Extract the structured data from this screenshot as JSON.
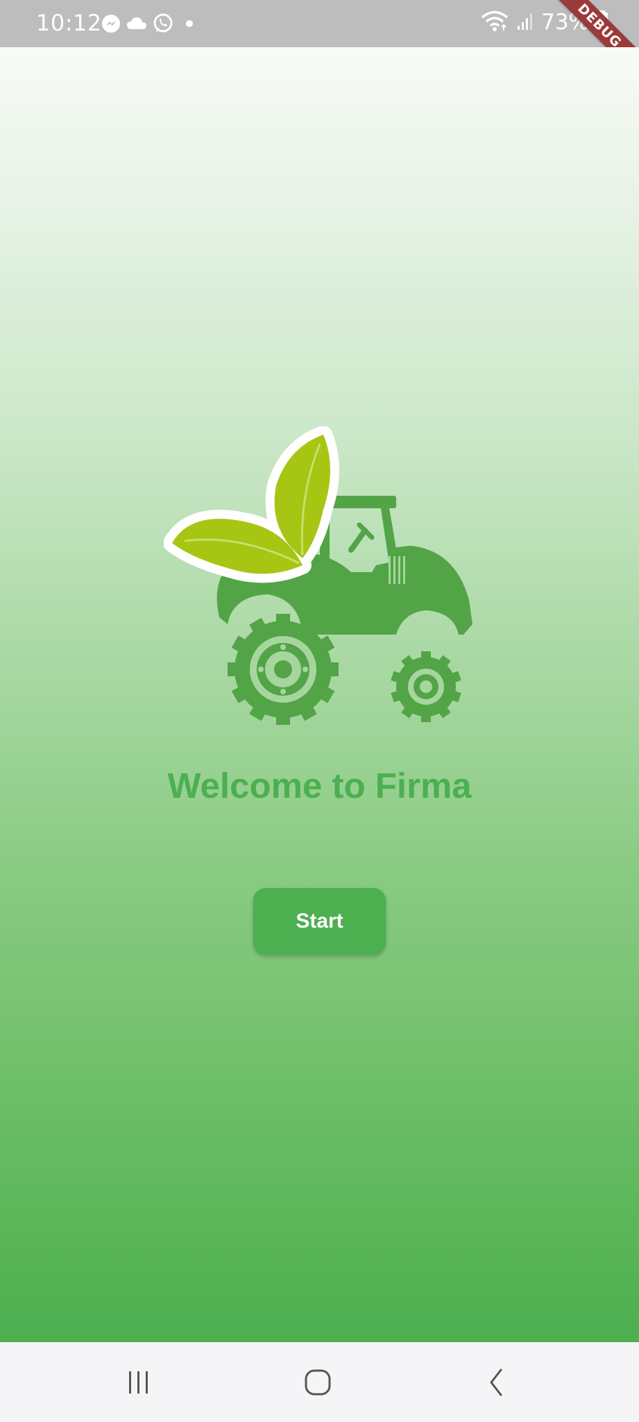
{
  "status_bar": {
    "time": "10:12",
    "battery": "73%",
    "left_icons": [
      "messenger-icon",
      "cloud-icon",
      "whatsapp-icon",
      "dot-icon"
    ],
    "right_icons": [
      "wifi-icon",
      "signal-icon",
      "battery-icon"
    ]
  },
  "debug_banner": {
    "label": "DEBUG"
  },
  "main": {
    "logo_icon": "tractor-leaf-logo",
    "title": "Welcome to Firma",
    "start_button_label": "Start"
  },
  "nav_bar": {
    "buttons": [
      "recent-apps-icon",
      "home-icon",
      "back-icon"
    ]
  },
  "colors": {
    "accent": "#4caf50",
    "tractor": "#52a447",
    "leaf": "#a7c614",
    "status_bar": "#bdbdbd",
    "debug_ribbon": "#9b3a3a"
  }
}
